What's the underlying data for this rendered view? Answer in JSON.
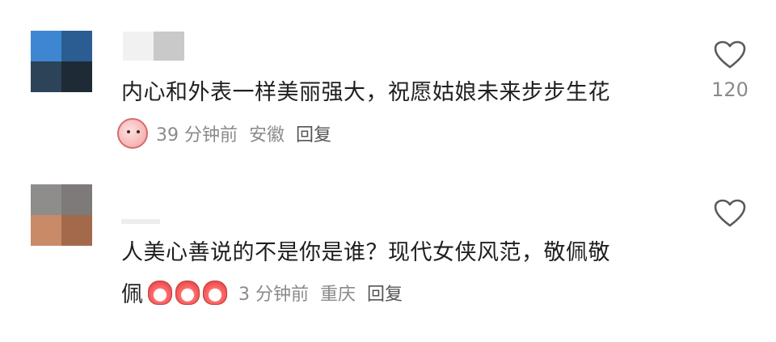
{
  "comments": [
    {
      "text": "内心和外表一样美丽强大，祝愿姑娘未来步步生花",
      "time": "39 分钟前",
      "location": "安徽",
      "reply_label": "回复",
      "likes": "120",
      "sticker_icon": "pink-face-sticker-icon"
    },
    {
      "text_line1": "人美心善说的不是你是谁？现代女侠风范，敬佩敬",
      "text_line2": "佩",
      "emoji_icons": [
        "thumbs-up-icon",
        "thumbs-up-icon",
        "thumbs-up-icon"
      ],
      "time": "3 分钟前",
      "location": "重庆",
      "reply_label": "回复"
    }
  ],
  "colors": {
    "text": "#1f1f1f",
    "meta": "#8a8a8a",
    "heart_stroke": "#5a5a5a"
  }
}
